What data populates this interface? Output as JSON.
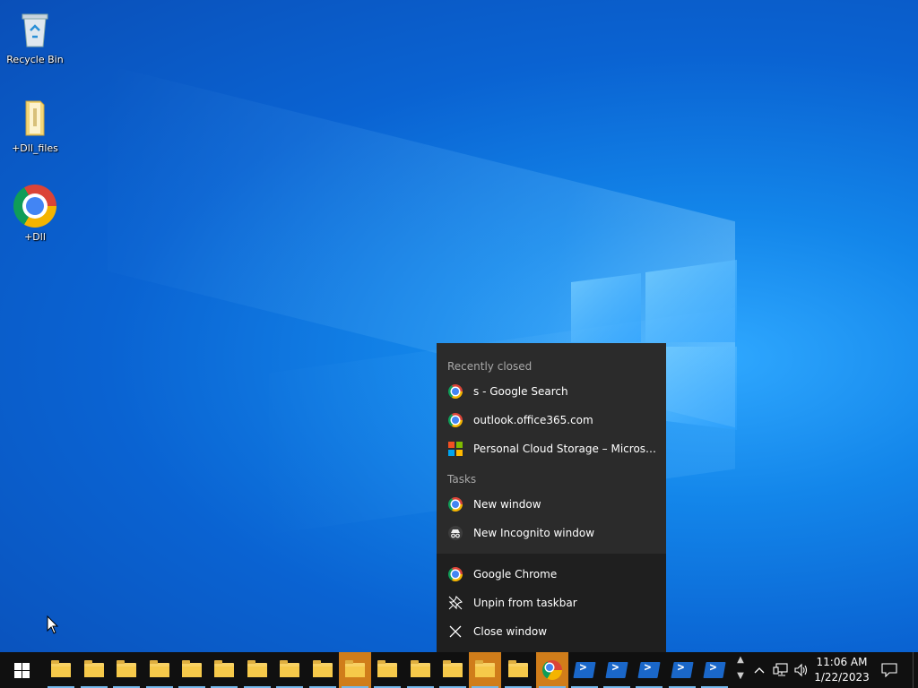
{
  "desktop": {
    "icons": [
      {
        "label": "Recycle Bin",
        "icon": "recycle-bin-icon"
      },
      {
        "label": "+Dll_files",
        "icon": "folder-icon"
      },
      {
        "label": "+Dll",
        "icon": "chrome-icon"
      }
    ]
  },
  "jumplist": {
    "recently_closed_header": "Recently closed",
    "recent": [
      {
        "label": "s - Google Search",
        "icon": "chrome-icon"
      },
      {
        "label": "outlook.office365.com",
        "icon": "chrome-icon"
      },
      {
        "label": "Personal Cloud Storage – Microsoft OneDrive",
        "icon": "microsoft-icon"
      }
    ],
    "tasks_header": "Tasks",
    "tasks": [
      {
        "label": "New window",
        "icon": "chrome-icon"
      },
      {
        "label": "New Incognito window",
        "icon": "incognito-icon"
      }
    ],
    "app_actions": [
      {
        "label": "Google Chrome",
        "icon": "chrome-icon"
      },
      {
        "label": "Unpin from taskbar",
        "icon": "unpin-icon"
      },
      {
        "label": "Close window",
        "icon": "close-icon"
      }
    ]
  },
  "taskbar": {
    "start_icon": "windows-logo-icon",
    "buttons": [
      {
        "icon": "file-explorer-icon"
      },
      {
        "icon": "file-explorer-icon"
      },
      {
        "icon": "file-explorer-icon"
      },
      {
        "icon": "file-explorer-icon"
      },
      {
        "icon": "file-explorer-icon"
      },
      {
        "icon": "file-explorer-icon"
      },
      {
        "icon": "file-explorer-icon"
      },
      {
        "icon": "file-explorer-icon"
      },
      {
        "icon": "file-explorer-icon"
      },
      {
        "icon": "file-explorer-icon"
      },
      {
        "icon": "file-explorer-icon"
      },
      {
        "icon": "file-explorer-icon"
      },
      {
        "icon": "file-explorer-icon"
      },
      {
        "icon": "file-explorer-icon"
      },
      {
        "icon": "file-explorer-icon"
      },
      {
        "icon": "chrome-icon"
      },
      {
        "icon": "powershell-icon"
      },
      {
        "icon": "powershell-icon"
      },
      {
        "icon": "powershell-icon"
      },
      {
        "icon": "powershell-icon"
      },
      {
        "icon": "powershell-icon"
      }
    ],
    "tray": {
      "time": "11:06 AM",
      "date": "1/22/2023"
    }
  },
  "colors": {
    "jumplist_bg": "#2b2b2b",
    "jumplist_bottom_bg": "#1f1f1f",
    "taskbar_bg": "#101010",
    "highlight": "#d07d1a",
    "accent": "#76b9ed"
  }
}
